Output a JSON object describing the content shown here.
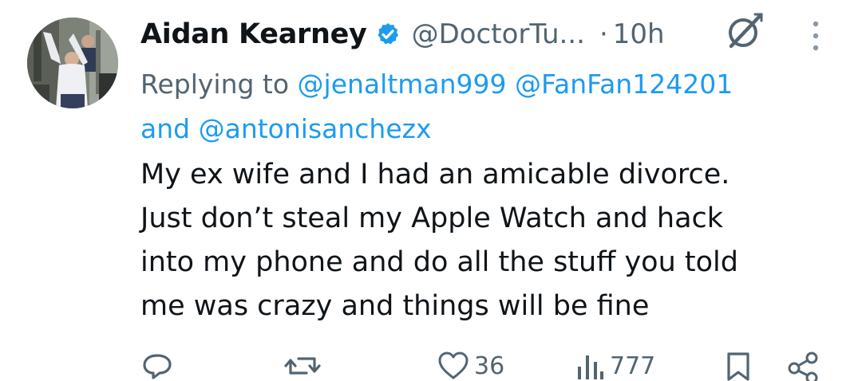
{
  "author": {
    "name": "Aidan Kearney",
    "handle": "@DoctorTu...",
    "separator": "·",
    "time": "10h",
    "verified": true
  },
  "reply": {
    "prefix": "Replying to",
    "mentions": [
      "@jenaltman999",
      "@FanFan124201",
      "@antonisanchezx"
    ],
    "conjunction": "and"
  },
  "tweet": {
    "lines": [
      "My ex wife and I had an amicable divorce.",
      "Just don’t steal my Apple Watch and hack",
      "into my phone and do all the stuff you told",
      "me was crazy and things will be fine"
    ]
  },
  "actions": {
    "reply_count": "",
    "retweet_count": "",
    "like_count": "36",
    "views_count": "777"
  },
  "icons": {
    "verified": "verified-badge-icon",
    "grok": "grok-icon",
    "more": "more-vertical-icon",
    "reply": "reply-icon",
    "retweet": "retweet-icon",
    "like": "heart-icon",
    "views": "views-icon",
    "bookmark": "bookmark-icon",
    "share": "share-icon"
  },
  "colors": {
    "text": "#0f1419",
    "secondary": "#536471",
    "link": "#1d9bf0",
    "verified": "#1d9bf0"
  }
}
